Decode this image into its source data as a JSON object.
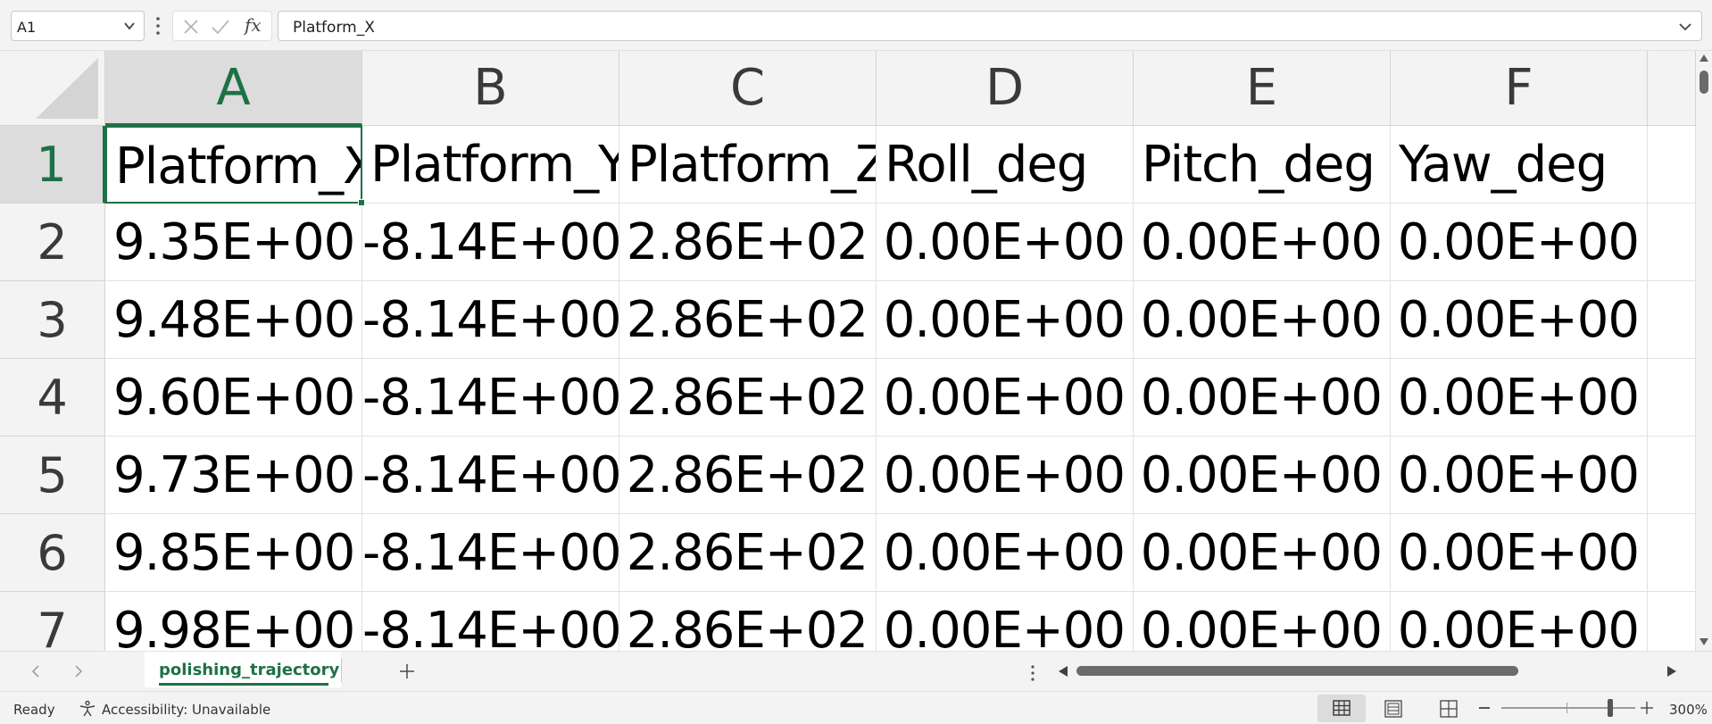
{
  "formula_bar": {
    "name_box": "A1",
    "fx_label": "fx",
    "formula": "Platform_X"
  },
  "grid": {
    "columns": [
      "A",
      "B",
      "C",
      "D",
      "E",
      "F"
    ],
    "rows": [
      "1",
      "2",
      "3",
      "4",
      "5",
      "6",
      "7"
    ],
    "cells": [
      [
        "Platform_X",
        "Platform_Y",
        "Platform_Z",
        "Roll_deg",
        "Pitch_deg",
        "Yaw_deg"
      ],
      [
        "9.35E+00",
        "-8.14E+00",
        "2.86E+02",
        "0.00E+00",
        "0.00E+00",
        "0.00E+00"
      ],
      [
        "9.48E+00",
        "-8.14E+00",
        "2.86E+02",
        "0.00E+00",
        "0.00E+00",
        "0.00E+00"
      ],
      [
        "9.60E+00",
        "-8.14E+00",
        "2.86E+02",
        "0.00E+00",
        "0.00E+00",
        "0.00E+00"
      ],
      [
        "9.73E+00",
        "-8.14E+00",
        "2.86E+02",
        "0.00E+00",
        "0.00E+00",
        "0.00E+00"
      ],
      [
        "9.85E+00",
        "-8.14E+00",
        "2.86E+02",
        "0.00E+00",
        "0.00E+00",
        "0.00E+00"
      ],
      [
        "9.98E+00",
        "-8.14E+00",
        "2.86E+02",
        "0.00E+00",
        "0.00E+00",
        "0.00E+00"
      ]
    ],
    "selected_cell": "A1"
  },
  "sheet_tabs": {
    "active_tab": "polishing_trajectory",
    "add_sheet_icon": "plus-icon"
  },
  "status_bar": {
    "ready": "Ready",
    "accessibility": "Accessibility: Unavailable",
    "zoom": "300%"
  },
  "colors": {
    "accent": "#1e7145",
    "header_bg": "#f3f3f3",
    "selected_header_bg": "#dcdcdc"
  }
}
